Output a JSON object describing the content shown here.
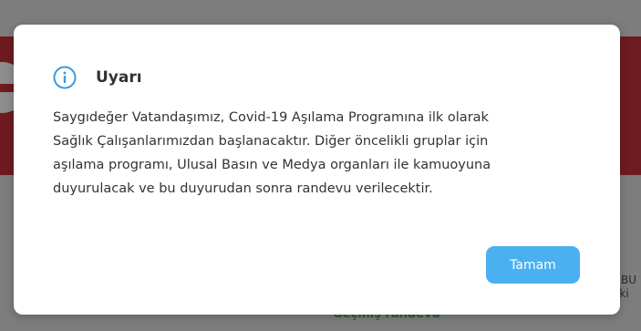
{
  "background": {
    "side_text_line1": "NBU",
    "side_text_line2": "eki",
    "appointment_text": "Geçmiş randevu"
  },
  "dialog": {
    "icon": "info-icon",
    "title": "Uyarı",
    "message_lines": [
      "Saygıdeğer Vatandaşımız, Covid-19 Aşılama Programına ilk olarak",
      "Sağlık Çalışanlarımızdan başlanacaktır. Diğer öncelikli gruplar için",
      "aşılama programı, Ulusal Basın ve Medya organları ile kamuoyuna",
      "duyurulacak ve bu duyurudan sonra randevu verilecektir."
    ],
    "ok_label": "Tamam"
  },
  "colors": {
    "accent": "#4ab0f0",
    "banner": "#6e1b1f"
  }
}
